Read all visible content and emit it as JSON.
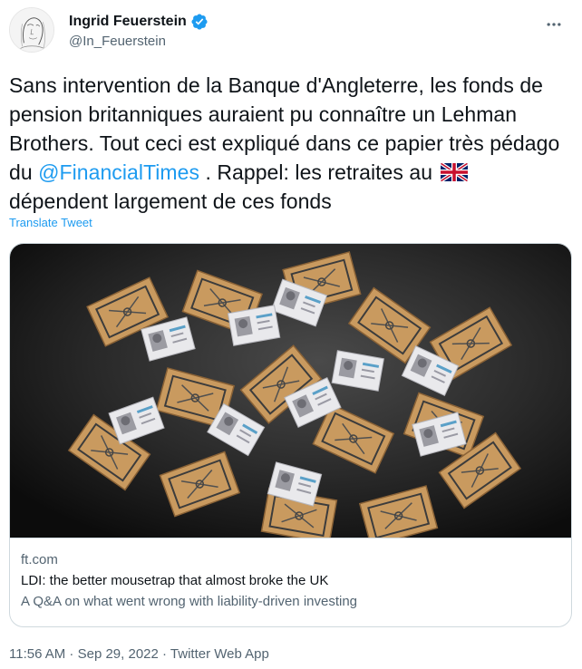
{
  "author": {
    "display_name": "Ingrid Feuerstein",
    "handle": "@In_Feuerstein",
    "verified": true
  },
  "tweet": {
    "text_part1": "Sans intervention de la Banque d'Angleterre, les fonds de pension britanniques auraient pu connaître un Lehman Brothers. Tout ceci est expliqué dans ce papier très pédago du ",
    "mention": "@FinancialTimes",
    "text_part2": " . Rappel: les retraites au ",
    "text_part3": " dépendent largement de ces fonds",
    "flag_icon": "uk-flag-icon",
    "translate_label": "Translate Tweet"
  },
  "card": {
    "domain": "ft.com",
    "title": "LDI: the better mousetrap that almost broke the UK",
    "description": "A Q&A on what went wrong with liability-driven investing"
  },
  "footer": {
    "time": "11:56 AM",
    "separator": " · ",
    "date": "Sep 29, 2022",
    "source": "Twitter Web App"
  },
  "colors": {
    "link": "#1d9bf0",
    "secondary_text": "#536471",
    "border": "#cfd9de",
    "verified": "#1d9bf0"
  }
}
